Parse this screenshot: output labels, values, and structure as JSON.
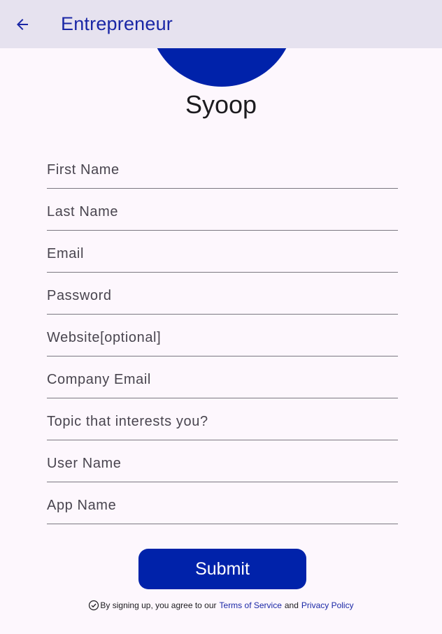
{
  "appbar": {
    "title": "Entrepreneur",
    "back_icon": "arrow-back-icon"
  },
  "profile": {
    "app_name": "Syoop"
  },
  "form": {
    "fields": [
      {
        "placeholder": "First Name",
        "value": ""
      },
      {
        "placeholder": "Last Name",
        "value": ""
      },
      {
        "placeholder": "Email",
        "value": ""
      },
      {
        "placeholder": "Password",
        "value": ""
      },
      {
        "placeholder": "Website[optional]",
        "value": ""
      },
      {
        "placeholder": "Company Email",
        "value": ""
      },
      {
        "placeholder": "Topic that interests you?",
        "value": ""
      },
      {
        "placeholder": "User Name",
        "value": ""
      },
      {
        "placeholder": "App Name",
        "value": ""
      }
    ],
    "submit_label": "Submit"
  },
  "terms": {
    "prefix": "By signing up, you agree to our",
    "terms_link": "Terms of Service",
    "and": "and",
    "privacy_link": "Privacy Policy",
    "icon": "check-circle-icon"
  },
  "colors": {
    "accent": "#0022aa",
    "appbar_bg": "#e6e2ef",
    "title": "#1a27a6",
    "background": "#fdf7fd"
  }
}
